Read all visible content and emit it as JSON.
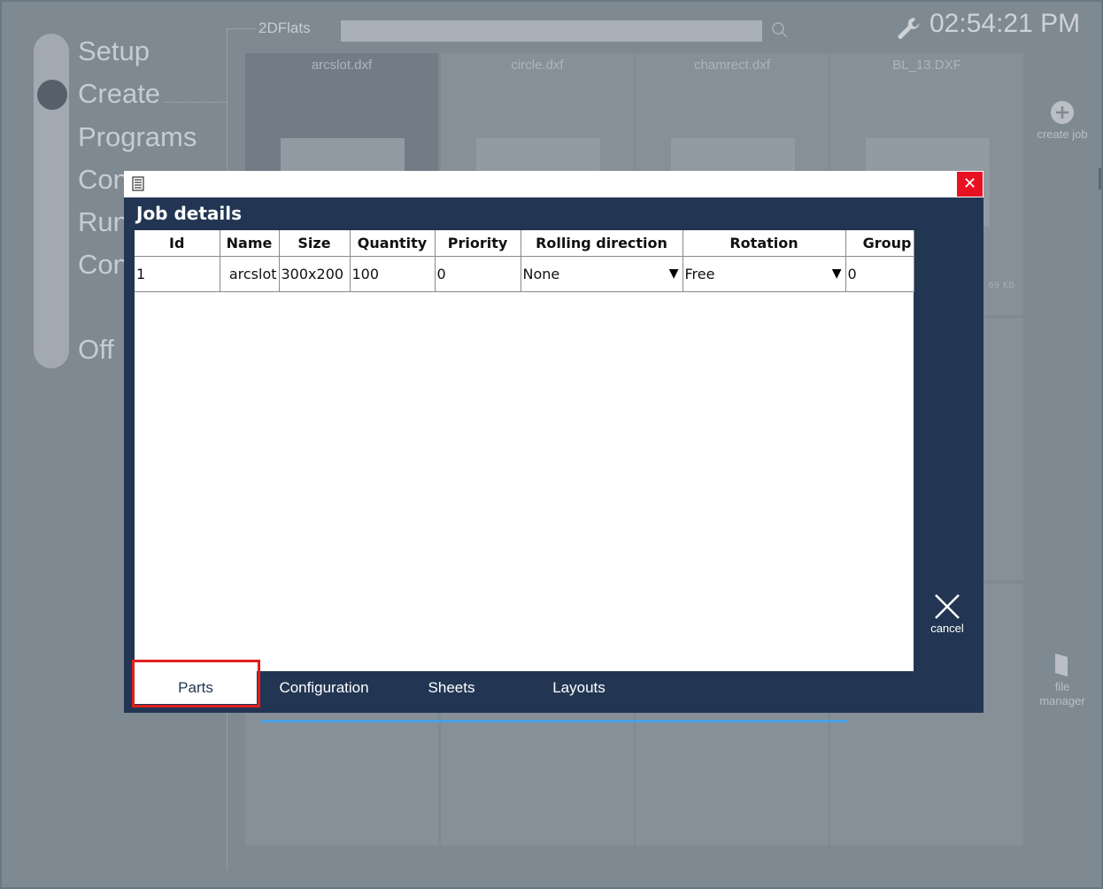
{
  "background": {
    "nav_items": [
      "Setup",
      "Create",
      "Programs",
      "Con",
      "Run",
      "Con",
      "Off"
    ],
    "folder": "2DFlats",
    "clock": "02:54:21 PM",
    "tiles": [
      {
        "name": "arcslot.dxf",
        "size": ""
      },
      {
        "name": "circle.dxf",
        "size": ""
      },
      {
        "name": "chamrect.dxf",
        "size": ""
      },
      {
        "name": "BL_13.DXF",
        "size": "69 KB"
      }
    ],
    "side_buttons": {
      "create_job": "create job",
      "file_manager_1": "file",
      "file_manager_2": "manager"
    }
  },
  "dialog": {
    "title": "Job details",
    "close_symbol": "✕",
    "columns": [
      "Id",
      "Name",
      "Size",
      "Quantity",
      "Priority",
      "Rolling direction",
      "Rotation",
      "Group"
    ],
    "row": {
      "id": "1",
      "name": "arcslot",
      "size": "300x200",
      "quantity": "100",
      "priority": "0",
      "rolling_direction": "None",
      "rotation": "Free",
      "group": "0"
    },
    "dropdown_arrow": "▼",
    "cancel": "cancel",
    "tabs": [
      "Parts",
      "Configuration",
      "Sheets",
      "Layouts"
    ],
    "active_tab": "Parts"
  },
  "colors": {
    "dialog_bg": "#223653",
    "close_red": "#e81123",
    "highlight_red": "#e02020",
    "scroll_blue": "#4aa0e6"
  }
}
